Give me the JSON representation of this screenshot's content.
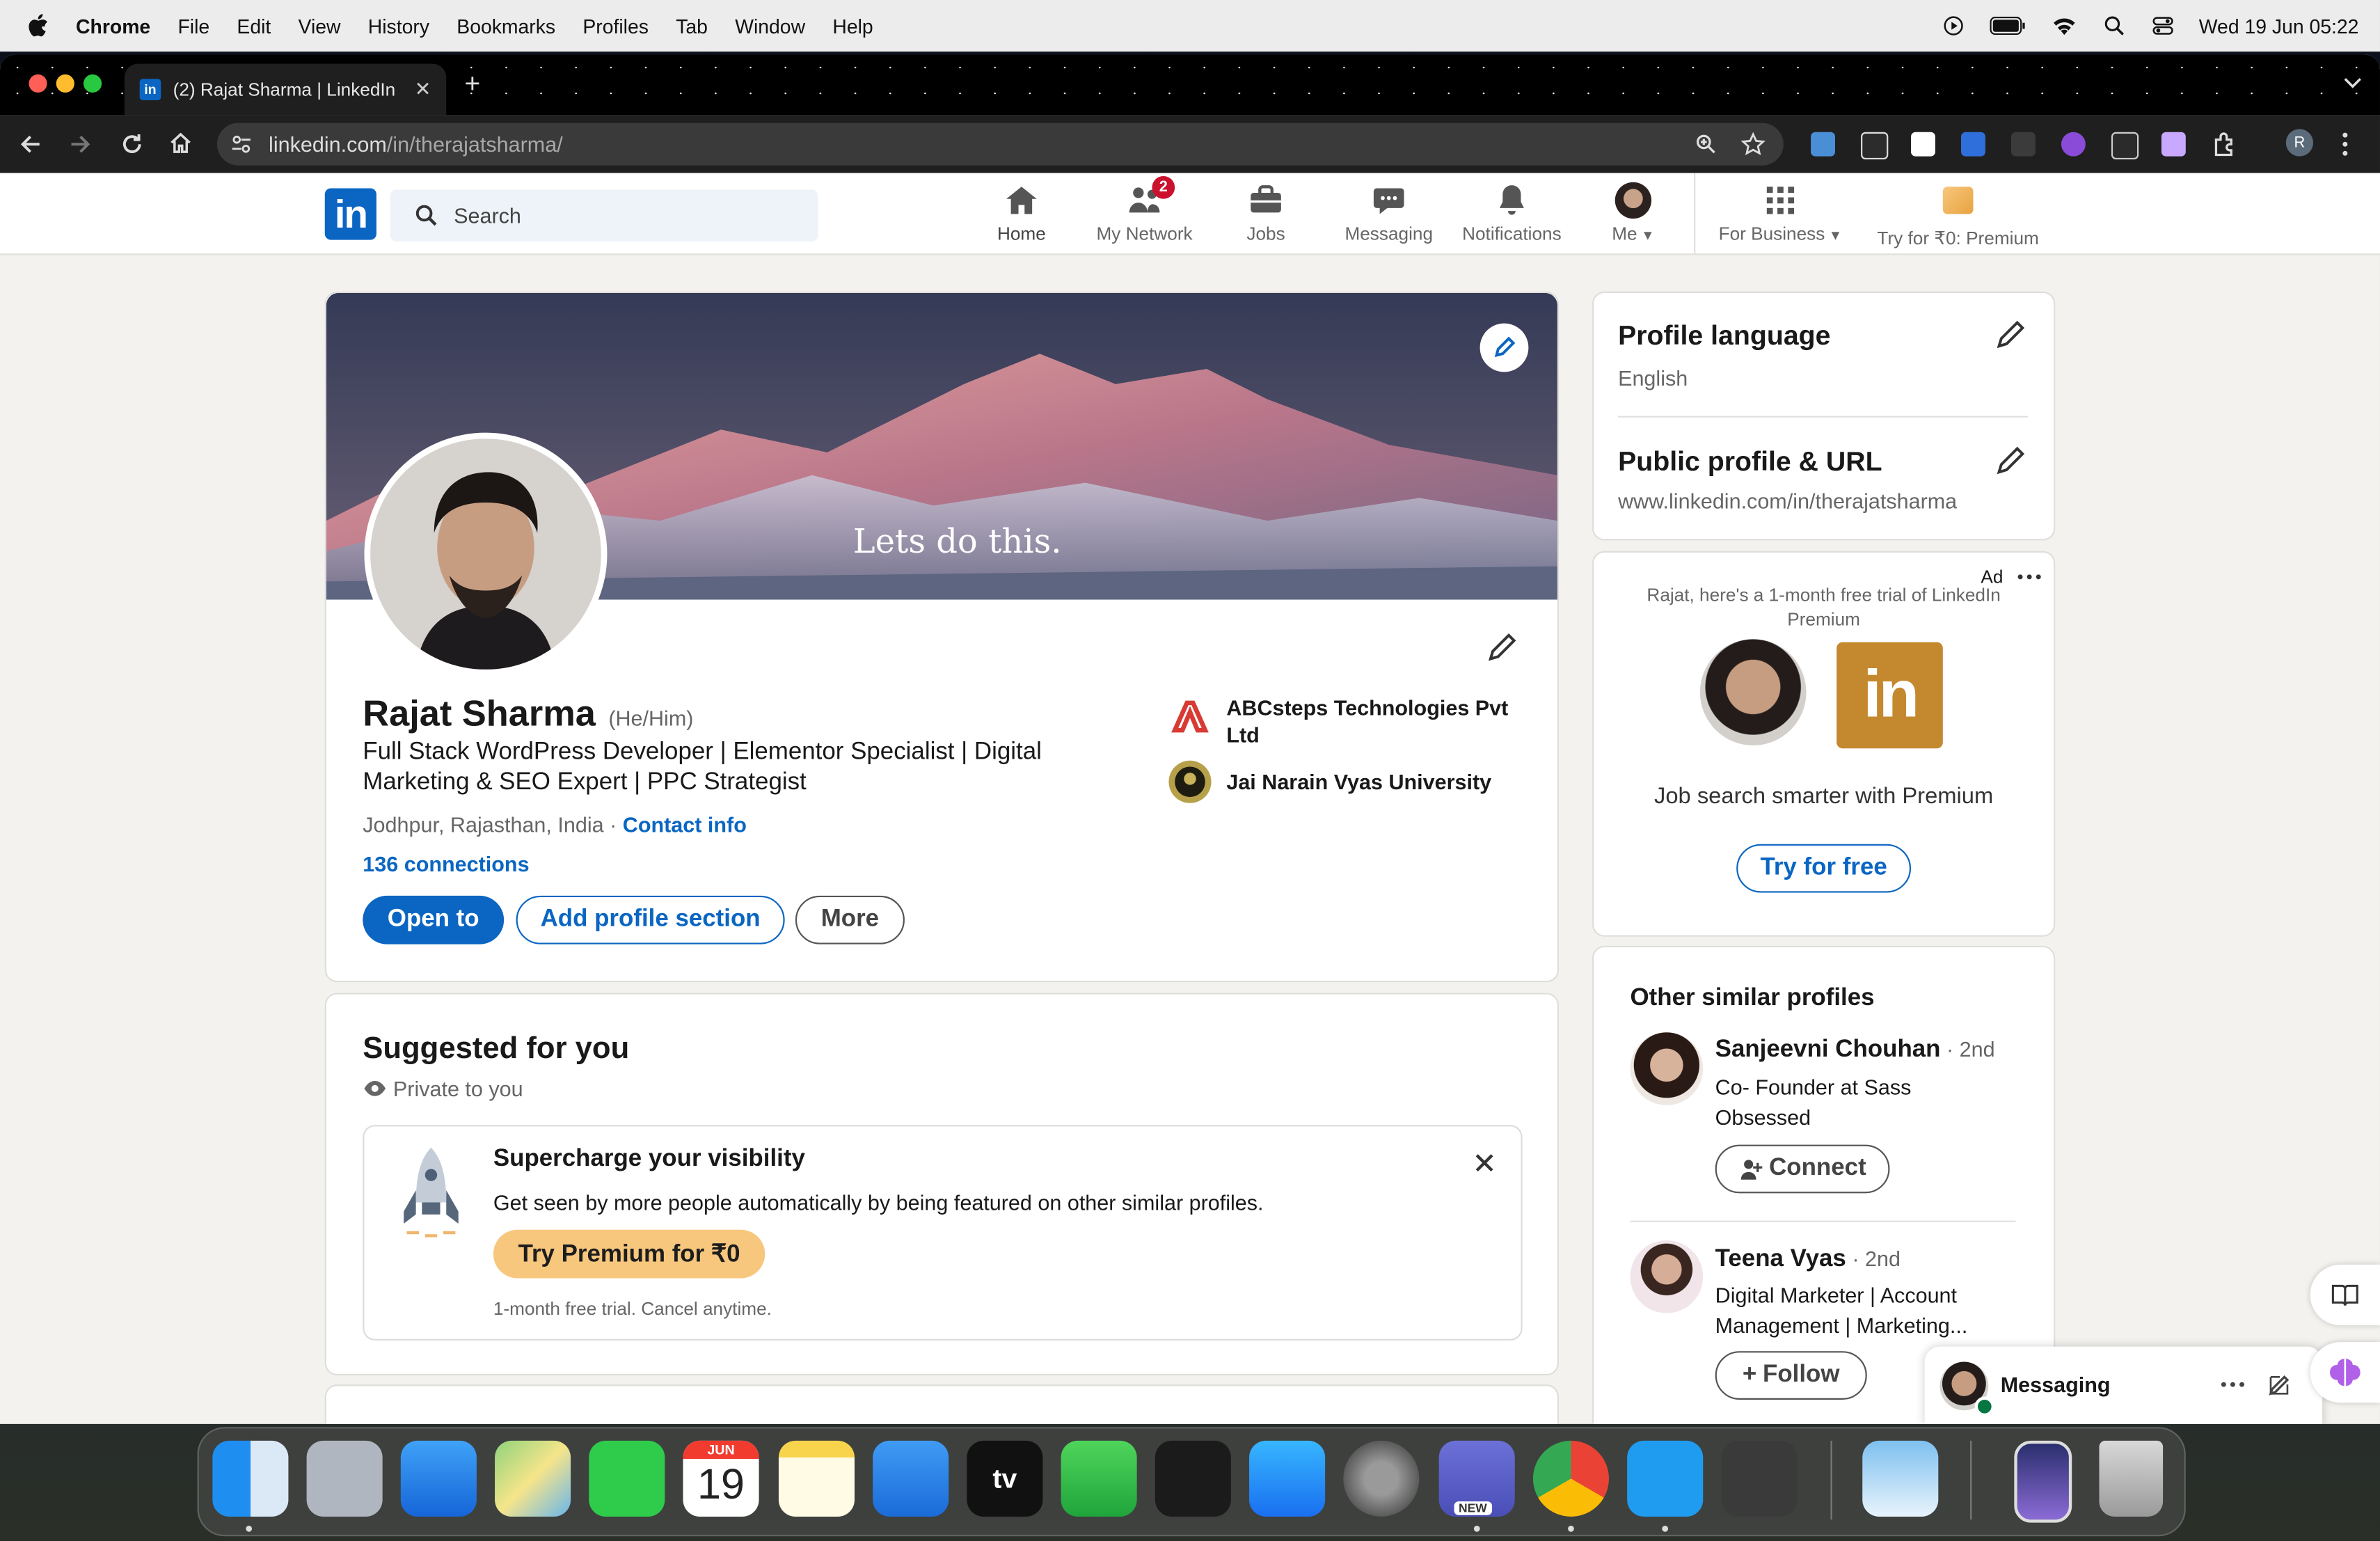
{
  "menubar": {
    "app": "Chrome",
    "items": [
      "File",
      "Edit",
      "View",
      "History",
      "Bookmarks",
      "Profiles",
      "Tab",
      "Window",
      "Help"
    ],
    "datetime": "Wed 19 Jun  05:22"
  },
  "browser": {
    "tab_title": "(2) Rajat Sharma | LinkedIn",
    "url_host": "linkedin.com",
    "url_path": "/in/therajatsharma/",
    "profile_initial": "R"
  },
  "nav": {
    "search_placeholder": "Search",
    "items": [
      {
        "label": "Home",
        "icon": "home-icon"
      },
      {
        "label": "My Network",
        "icon": "network-icon",
        "badge": "2"
      },
      {
        "label": "Jobs",
        "icon": "briefcase-icon"
      },
      {
        "label": "Messaging",
        "icon": "chat-icon"
      },
      {
        "label": "Notifications",
        "icon": "bell-icon"
      },
      {
        "label": "Me",
        "icon": "avatar"
      }
    ],
    "for_business": "For Business",
    "premium": "Try for ₹0: Premium"
  },
  "profile": {
    "banner_text": "Lets do this.",
    "name": "Rajat Sharma",
    "pronouns": "(He/Him)",
    "headline": "Full Stack WordPress Developer | Elementor Specialist | Digital Marketing & SEO Expert | PPC Strategist",
    "location": "Jodhpur, Rajasthan, India · ",
    "contact": "Contact info",
    "connections": "136 connections",
    "company": "ABCsteps Technologies Pvt Ltd",
    "university": "Jai Narain Vyas University",
    "btn_open": "Open to",
    "btn_add": "Add profile section",
    "btn_more": "More"
  },
  "suggested": {
    "title": "Suggested for you",
    "private": "Private to you",
    "promo_title": "Supercharge your visibility",
    "promo_text": "Get seen by more people automatically by being featured on other similar profiles.",
    "promo_btn": "Try Premium for ₹0",
    "promo_note": "1-month free trial. Cancel anytime."
  },
  "sidebar": {
    "lang_title": "Profile language",
    "lang_value": "English",
    "url_title": "Public profile & URL",
    "url_value": "www.linkedin.com/in/therajatsharma",
    "ad_label": "Ad",
    "ad_text": "Rajat, here's a 1-month free trial of LinkedIn Premium",
    "ad_tagline": "Job search smarter with Premium",
    "ad_btn": "Try for free",
    "similar_title": "Other similar profiles",
    "people": [
      {
        "name": "Sanjeevni Chouhan",
        "degree": " · 2nd",
        "headline": "Co- Founder at Sass Obsessed",
        "action": "Connect"
      },
      {
        "name": "Teena Vyas",
        "degree": " · 2nd",
        "headline": "Digital Marketer | Account Management | Marketing...",
        "action": "Follow"
      }
    ]
  },
  "messaging": {
    "label": "Messaging"
  },
  "dock": {
    "calendar_month": "JUN",
    "calendar_day": "19",
    "teams_badge": "NEW"
  },
  "colors": {
    "linkedin_blue": "#0a66c2",
    "premium_gold": "#f8c77e",
    "badge_red": "#cb112d"
  }
}
